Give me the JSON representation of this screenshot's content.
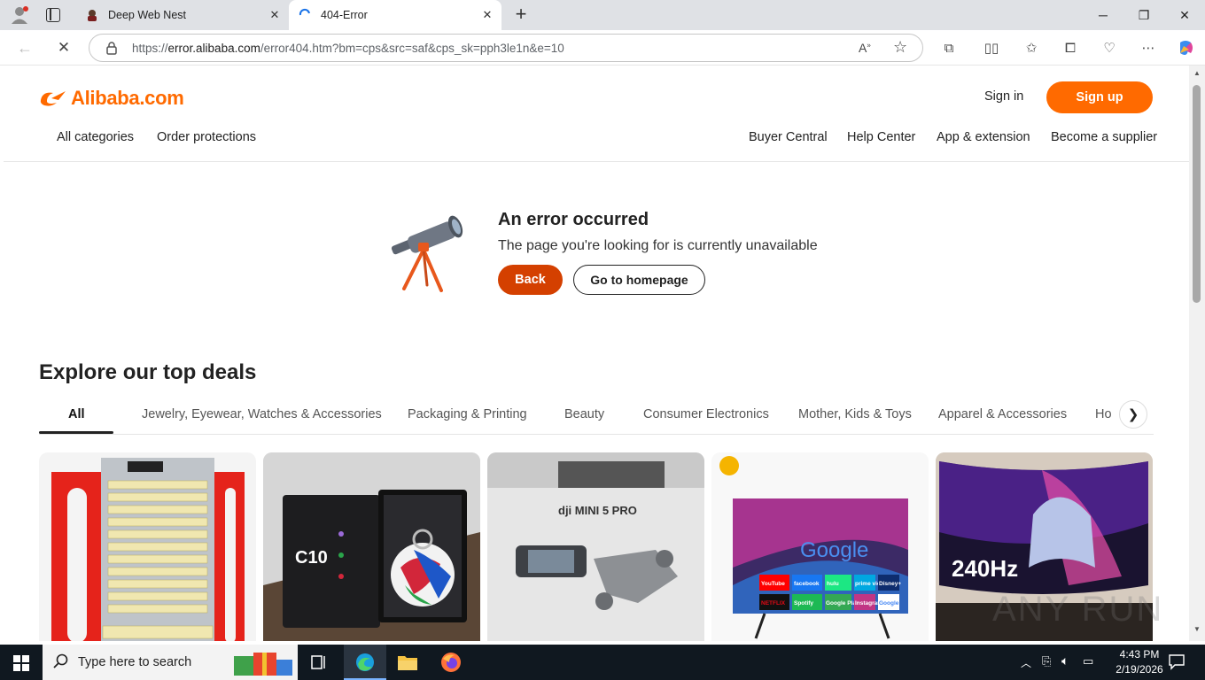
{
  "browser": {
    "tabs": [
      {
        "title": "Deep Web Nest"
      },
      {
        "title": "404-Error"
      }
    ],
    "url": {
      "prefix": "https://",
      "host": "error.alibaba.com",
      "path": "/error404.htm?bm=cps&src=saf&cps_sk=pph3le1n&e=10"
    }
  },
  "header": {
    "logo": "Alibaba.com",
    "sign_in": "Sign in",
    "sign_up": "Sign up",
    "nav_left": [
      "All categories",
      "Order protections"
    ],
    "nav_right": [
      "Buyer Central",
      "Help Center",
      "App & extension",
      "Become a supplier"
    ]
  },
  "error": {
    "title": "An error occurred",
    "subtitle": "The page you're looking for is currently unavailable",
    "back_label": "Back",
    "home_label": "Go to homepage"
  },
  "deals": {
    "title": "Explore our top deals",
    "categories": [
      "All",
      "Jewelry, Eyewear, Watches & Accessories",
      "Packaging & Printing",
      "Beauty",
      "Consumer Electronics",
      "Mother, Kids & Toys",
      "Apparel & Accessories",
      "Ho"
    ],
    "active_category": "All",
    "cards": [
      {
        "image": "egg-incubator"
      },
      {
        "image": "football-keychain",
        "text": "C10"
      },
      {
        "image": "drone-box",
        "text": "dji MINI 5 PRO"
      },
      {
        "image": "smart-tv",
        "text": "Google"
      },
      {
        "image": "curved-monitor",
        "text": "240Hz"
      }
    ],
    "card_tv_apps": [
      "YouTube",
      "facebook",
      "hulu",
      "prime video",
      "Disney+",
      "NETFLIX",
      "Spotify",
      "Google Play",
      "Instagram",
      "Google"
    ]
  },
  "watermark": "ANY RUN",
  "taskbar": {
    "search_placeholder": "Type here to search",
    "time": "4:43 PM",
    "date": "2/19/2026"
  },
  "colors": {
    "brand": "#ff6a00",
    "back_button": "#d44000",
    "taskbar": "#101820"
  }
}
